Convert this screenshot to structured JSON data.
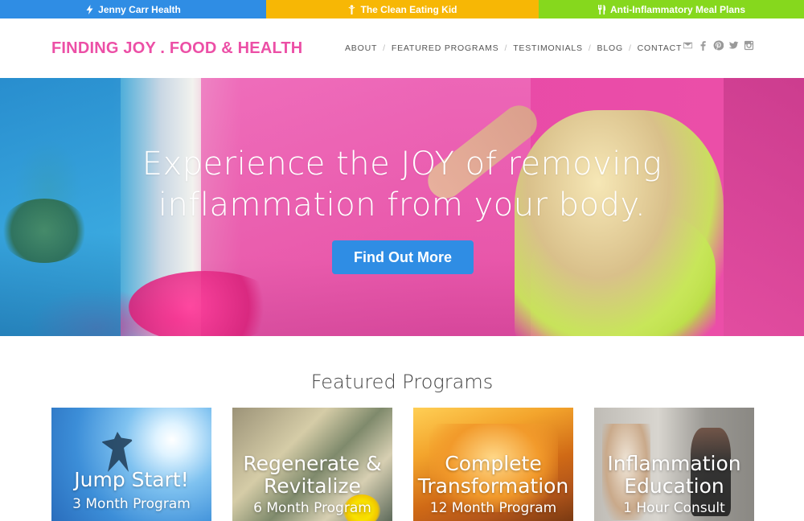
{
  "topbar": {
    "items": [
      {
        "label": "Jenny Carr Health",
        "icon": "lightning-icon",
        "color": "#2f8de4"
      },
      {
        "label": "The Clean Eating Kid",
        "icon": "kid-icon",
        "color": "#f7b705"
      },
      {
        "label": "Anti-Inflammatory Meal Plans",
        "icon": "utensils-icon",
        "color": "#86d81d"
      }
    ]
  },
  "header": {
    "logo": "FINDING JOY . FOOD & HEALTH",
    "logo_color": "#ec4fa6",
    "nav": [
      "ABOUT",
      "FEATURED PROGRAMS",
      "TESTIMONIALS",
      "BLOG",
      "CONTACT"
    ],
    "social_icons": [
      "mail-icon",
      "facebook-icon",
      "pinterest-icon",
      "twitter-icon",
      "instagram-icon"
    ]
  },
  "hero": {
    "title_line1": "Experience the JOY of removing",
    "title_line2": "inflammation from your body.",
    "button_label": "Find Out More",
    "button_color": "#2f8de4"
  },
  "featured": {
    "heading": "Featured Programs",
    "cards": [
      {
        "title_line1": "Jump Start!",
        "title_line2": "",
        "subtitle": "3 Month Program"
      },
      {
        "title_line1": "Regenerate &",
        "title_line2": "Revitalize",
        "subtitle": "6 Month Program"
      },
      {
        "title_line1": "Complete",
        "title_line2": "Transformation",
        "subtitle": "12 Month Program"
      },
      {
        "title_line1": "Inflammation",
        "title_line2": "Education",
        "subtitle": "1 Hour Consult"
      }
    ]
  }
}
